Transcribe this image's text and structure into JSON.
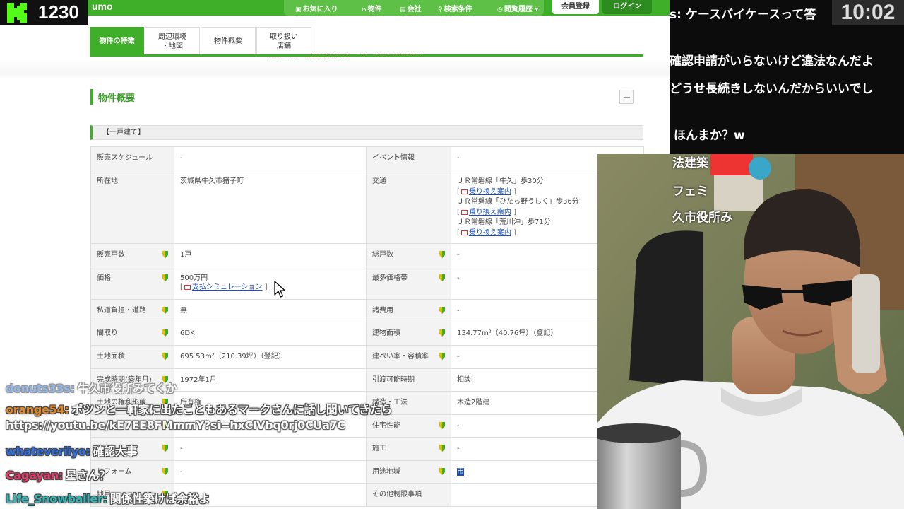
{
  "counter": {
    "value": "1230"
  },
  "clock": {
    "time": "10:02"
  },
  "site": {
    "logo_tail": "umo",
    "nav": {
      "favorites": "お気に入り",
      "properties": "物件",
      "companies": "会社",
      "search_conditions": "検索条件",
      "history": "閲覧履歴",
      "register": "会員登録",
      "login": "ログイン"
    },
    "tabs": [
      {
        "label": "物件の特徴",
        "active": true
      },
      {
        "label": "周辺環境\n・地図",
        "active": false
      },
      {
        "label": "物件概要",
        "active": false
      },
      {
        "label": "取り扱い\n店舗",
        "active": false
      }
    ],
    "cut_text": "問合せ先：　【通話料無料】　TEL：0120505-952"
  },
  "section": {
    "title": "物件概要",
    "type_header": "【一戸建て】"
  },
  "spec": {
    "sales_schedule": {
      "label": "販売スケジュール",
      "value": "-"
    },
    "event_info": {
      "label": "イベント情報",
      "value": "-"
    },
    "location": {
      "label": "所在地",
      "value": "茨城県牛久市猪子町"
    },
    "transport": {
      "label": "交通",
      "routes": [
        {
          "line": "ＪＲ常磐線「牛久」歩30分",
          "link": "乗り換え案内"
        },
        {
          "line": "ＪＲ常磐線「ひたち野うしく」歩36分",
          "link": "乗り換え案内"
        },
        {
          "line": "ＪＲ常磐線「荒川沖」歩71分",
          "link": "乗り換え案内"
        }
      ]
    },
    "units_for_sale": {
      "label": "販売戸数",
      "value": "1戸"
    },
    "total_units": {
      "label": "総戸数",
      "value": "-"
    },
    "price": {
      "label": "価格",
      "value": "500万円",
      "link": "支払シミュレーション"
    },
    "popular_price": {
      "label": "最多価格帯",
      "value": "-"
    },
    "private_road": {
      "label": "私道負担・道路",
      "value": "無"
    },
    "misc_costs": {
      "label": "諸費用",
      "value": "-"
    },
    "layout": {
      "label": "間取り",
      "value": "6DK"
    },
    "building_area": {
      "label": "建物面積",
      "value": "134.77m²（40.76坪）（登記）"
    },
    "land_area": {
      "label": "土地面積",
      "value": "695.53m²（210.39坪）（登記）"
    },
    "coverage": {
      "label": "建ぺい率・容積率",
      "value": "-"
    },
    "built": {
      "label": "完成時期(築年月)",
      "value": "1972年1月"
    },
    "handover": {
      "label": "引渡可能時期",
      "value": "相談"
    },
    "land_rights": {
      "label": "土地の権利形態",
      "value": "所有権"
    },
    "structure": {
      "label": "構造・工法",
      "value": "木造2階建"
    },
    "performance": {
      "label": "住宅性能",
      "value": "-"
    },
    "row9_left": {
      "label": "",
      "value": "-"
    },
    "construction": {
      "label": "施工",
      "value": "-"
    },
    "row10_left": {
      "label": "リフォーム",
      "value": "-"
    },
    "zoning": {
      "label": "用途地域",
      "value": "市"
    },
    "row11_left": {
      "label": "地目",
      "value": ""
    },
    "other_restrictions": {
      "label": "その他制限事項",
      "value": ""
    }
  },
  "chat_overlay": [
    {
      "user": "donuts33s:",
      "text": "牛久市役所みてくか",
      "color": "#3f7fd9"
    },
    {
      "user": "orange54:",
      "text": "ポツンと一軒家に出たこともあるマークさんに話し聞いてきたら",
      "color": "#e0892a"
    },
    {
      "user": "",
      "text": "https://youtu.be/kE7EE8FMmmY?si=hxClVbq0rj0CUa7C",
      "color": "#ffffff"
    },
    {
      "user": "whateveriiyo:",
      "text": "確認大事",
      "color": "#2f6fe0"
    },
    {
      "user": "Cagayan:",
      "text": "星さん？",
      "color": "#e23b6a"
    },
    {
      "user": "Life_Snowballer:",
      "text": "関係性築けば余裕よ",
      "color": "#32b8b8"
    }
  ],
  "right_chat": [
    {
      "text": "s: ケースバイケースって答"
    },
    {
      "text": "確認申請がいらないけど違法なんだよ"
    },
    {
      "text": "どうせ長続きしないんだからいいでし"
    },
    {
      "text": "ほんまか？w"
    },
    {
      "text": "法建築"
    },
    {
      "text": "フェミ"
    },
    {
      "text": "久市役所み"
    }
  ]
}
